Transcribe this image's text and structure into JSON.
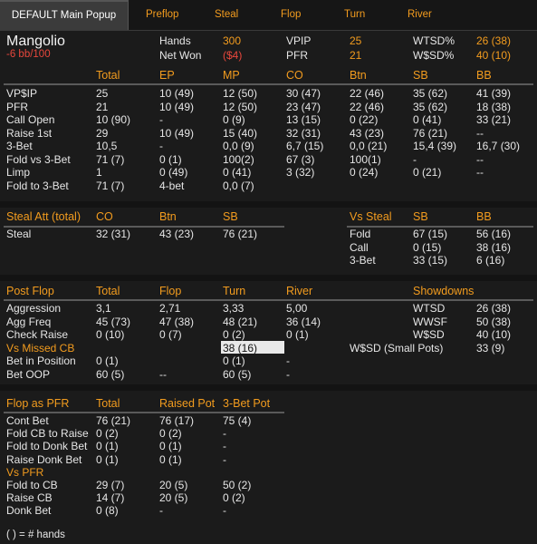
{
  "tabs": [
    "DEFAULT Main Popup",
    "Preflop",
    "Steal",
    "Flop",
    "Turn",
    "River"
  ],
  "player": {
    "name": "Mangolio",
    "bb100": "-6 bb/100"
  },
  "summary": [
    {
      "label": "Hands",
      "value": "300"
    },
    {
      "label": "Net Won",
      "value": "($4)"
    },
    {
      "label": "VPIP",
      "value": "25"
    },
    {
      "label": "PFR",
      "value": "21"
    },
    {
      "label": "WTSD%",
      "value": "26 (38)"
    },
    {
      "label": "W$SD%",
      "value": "40 (10)"
    }
  ],
  "preflop": {
    "columns": [
      "Total",
      "EP",
      "MP",
      "CO",
      "Btn",
      "SB",
      "BB"
    ],
    "rows": [
      {
        "label": "VP$IP",
        "cells": [
          "25",
          "10 (49)",
          "12 (50)",
          "30 (47)",
          "22 (46)",
          "35 (62)",
          "41 (39)"
        ]
      },
      {
        "label": "PFR",
        "cells": [
          "21",
          "10 (49)",
          "12 (50)",
          "23 (47)",
          "22 (46)",
          "35 (62)",
          "18 (38)"
        ]
      },
      {
        "label": "Call Open",
        "cells": [
          "10 (90)",
          "-",
          "0 (9)",
          "13 (15)",
          "0 (22)",
          "0 (41)",
          "33 (21)"
        ]
      },
      {
        "label": "Raise 1st",
        "cells": [
          "29",
          "10 (49)",
          "15 (40)",
          "32 (31)",
          "43 (23)",
          "76 (21)",
          "--"
        ]
      },
      {
        "label": "3-Bet",
        "cells": [
          "10,5",
          "-",
          "0,0 (9)",
          "6,7 (15)",
          "0,0 (21)",
          "15,4 (39)",
          "16,7 (30)"
        ]
      },
      {
        "label": "Fold vs 3-Bet",
        "cells": [
          "71 (7)",
          "0 (1)",
          "100(2)",
          "67 (3)",
          "100(1)",
          "-",
          "--"
        ]
      },
      {
        "label": "Limp",
        "cells": [
          "1",
          "0 (49)",
          "0 (41)",
          "3 (32)",
          "0 (24)",
          "0 (21)",
          "--"
        ]
      },
      {
        "label": "Fold to 3-Bet",
        "cells": [
          "71 (7)",
          "4-bet",
          "0,0 (7)",
          "",
          "",
          "",
          ""
        ]
      }
    ]
  },
  "steal": {
    "title": "Steal Att (total)",
    "columns": [
      "CO",
      "Btn",
      "SB"
    ],
    "row": {
      "label": "Steal",
      "cells": [
        "32 (31)",
        "43 (23)",
        "76 (21)"
      ]
    },
    "vs_title": "Vs Steal",
    "vs_columns": [
      "SB",
      "BB"
    ],
    "vs_rows": [
      {
        "label": "Fold",
        "cells": [
          "67 (15)",
          "56 (16)"
        ]
      },
      {
        "label": "Call",
        "cells": [
          "0 (15)",
          "38 (16)"
        ]
      },
      {
        "label": "3-Bet",
        "cells": [
          "33 (15)",
          "6 (16)"
        ]
      }
    ]
  },
  "postflop": {
    "title": "Post Flop",
    "columns": [
      "Total",
      "Flop",
      "Turn",
      "River"
    ],
    "rows": [
      {
        "label": "Aggression",
        "cells": [
          "3,1",
          "2,71",
          "3,33",
          "5,00"
        ]
      },
      {
        "label": "Agg Freq",
        "cells": [
          "45 (73)",
          "47 (38)",
          "48 (21)",
          "36 (14)"
        ]
      },
      {
        "label": "Check Raise",
        "cells": [
          "0 (10)",
          "0 (7)",
          "0 (2)",
          "0 (1)"
        ]
      },
      {
        "label": "Vs Missed CB",
        "cells": [
          "",
          "",
          "38 (16)",
          ""
        ]
      },
      {
        "label": "Bet in Position",
        "cells": [
          "0 (1)",
          "",
          "0 (1)",
          "-"
        ]
      },
      {
        "label": "Bet OOP",
        "cells": [
          "60 (5)",
          "--",
          "60 (5)",
          "-"
        ]
      }
    ],
    "showdowns_title": "Showdowns",
    "showdowns": [
      {
        "label": "WTSD",
        "value": "26 (38)"
      },
      {
        "label": "WWSF",
        "value": "50 (38)"
      },
      {
        "label": "W$SD",
        "value": "40 (10)"
      },
      {
        "label": "W$SD (Small Pots)",
        "value": "33 (9)"
      }
    ]
  },
  "pfr": {
    "title": "Flop as PFR",
    "columns": [
      "Total",
      "Raised Pot",
      "3-Bet Pot"
    ],
    "rows": [
      {
        "label": "Cont Bet",
        "cells": [
          "76 (21)",
          "76 (17)",
          "75 (4)"
        ]
      },
      {
        "label": "Fold CB to Raise",
        "cells": [
          "0 (2)",
          "0 (2)",
          "-"
        ]
      },
      {
        "label": "Fold to Donk Bet",
        "cells": [
          "0 (1)",
          "0 (1)",
          "-"
        ]
      },
      {
        "label": "Raise Donk Bet",
        "cells": [
          "0 (1)",
          "0 (1)",
          "-"
        ]
      }
    ],
    "vs_title": "Vs PFR",
    "vs_rows": [
      {
        "label": "Fold to CB",
        "cells": [
          "29 (7)",
          "20 (5)",
          "50 (2)"
        ]
      },
      {
        "label": "Raise CB",
        "cells": [
          "14 (7)",
          "20 (5)",
          "0 (2)"
        ]
      },
      {
        "label": "Donk Bet",
        "cells": [
          "0 (8)",
          "-",
          "-"
        ]
      }
    ]
  },
  "footer": "( ) = # hands",
  "colors": {
    "accent": "#f39c1e",
    "negative": "#e8473c",
    "background": "#1b1b1b"
  }
}
